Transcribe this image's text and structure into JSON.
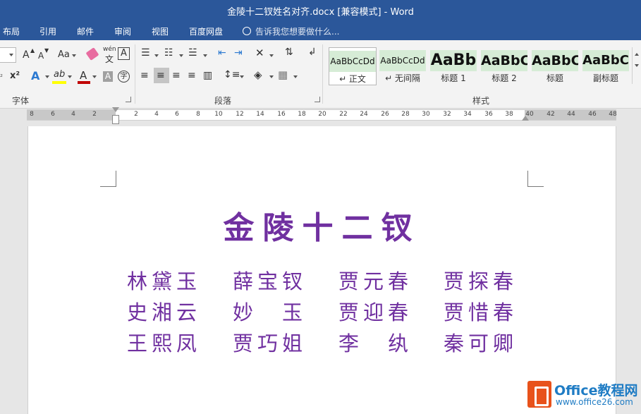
{
  "window": {
    "title": "金陵十二钗姓名对齐.docx [兼容模式] - Word"
  },
  "menu": {
    "tabs": [
      "布局",
      "引用",
      "邮件",
      "审阅",
      "视图",
      "百度网盘"
    ],
    "tell_me": "告诉我您想要做什么..."
  },
  "ribbon": {
    "groups": {
      "font": "字体",
      "paragraph": "段落",
      "styles": "样式"
    },
    "font": {
      "grow": "A",
      "shrink": "A",
      "case": "Aa",
      "phonetic_top": "wén",
      "phonetic_bottom": "文",
      "border_char": "A",
      "superscript": "x²",
      "effects": "A",
      "highlight": "ab",
      "color": "A",
      "shade": "A",
      "enclose": "字",
      "color_underline": "#c00000",
      "highlight_underline": "#ffff00"
    },
    "styles": [
      {
        "sample": "AaBbCcDd",
        "name": "↵ 正文"
      },
      {
        "sample": "AaBbCcDd",
        "name": "↵ 无间隔"
      },
      {
        "sample": "AaBb",
        "name": "标题 1"
      },
      {
        "sample": "AaBbC",
        "name": "标题 2"
      },
      {
        "sample": "AaBbC",
        "name": "标题"
      },
      {
        "sample": "AaBbC",
        "name": "副标题"
      }
    ]
  },
  "ruler": {
    "ticks": [
      "8",
      "6",
      "4",
      "2",
      "2",
      "4",
      "6",
      "8",
      "10",
      "12",
      "14",
      "16",
      "18",
      "20",
      "22",
      "24",
      "26",
      "28",
      "30",
      "32",
      "34",
      "36",
      "38",
      "40",
      "42",
      "44",
      "46",
      "48"
    ]
  },
  "document": {
    "title": "金陵十二钗",
    "rows": [
      [
        "林黛玉",
        "薛宝钗",
        "贾元春",
        "贾探春"
      ],
      [
        "史湘云",
        "妙　玉",
        "贾迎春",
        "贾惜春"
      ],
      [
        "王熙凤",
        "贾巧姐",
        "李　纨",
        "秦可卿"
      ]
    ],
    "text_color": "#7030a0"
  },
  "watermark": {
    "brand": "Office教程网",
    "url": "www.office26.com"
  },
  "colors": {
    "accent": "#2b579a"
  }
}
